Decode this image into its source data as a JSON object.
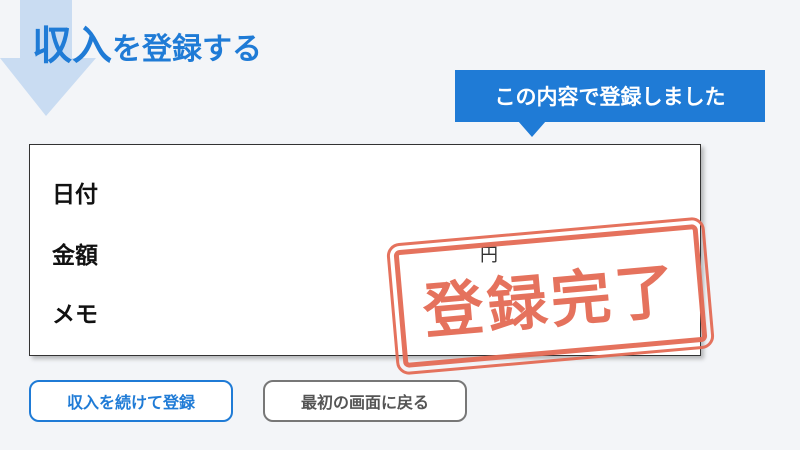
{
  "header": {
    "title_emphasis": "収入",
    "title_rest": "を登録する"
  },
  "callout": {
    "text": "この内容で登録しました"
  },
  "form": {
    "date_label": "日付",
    "amount_label": "金額",
    "amount_unit": "円",
    "memo_label": "メモ"
  },
  "stamp": {
    "text": "登録完了"
  },
  "buttons": {
    "continue_label": "収入を続けて登録",
    "home_label": "最初の画面に戻る"
  },
  "colors": {
    "accent": "#1f7bd6",
    "stamp": "#e46b55",
    "background": "#f3f5f8"
  },
  "icons": {
    "background_arrow": "down-arrow-icon"
  }
}
